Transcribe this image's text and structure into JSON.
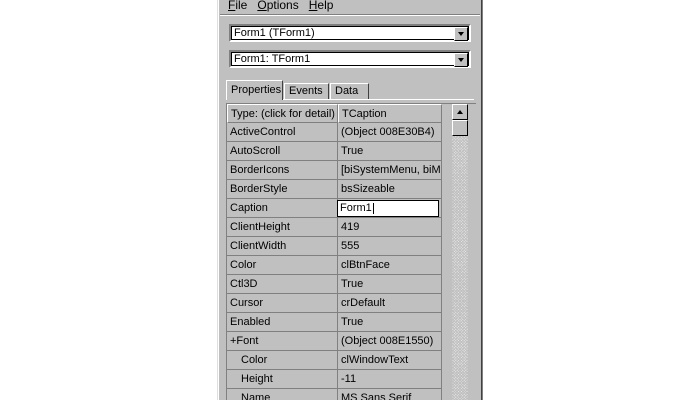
{
  "menu": {
    "items": [
      {
        "acc": "F",
        "rest": "ile"
      },
      {
        "acc": "O",
        "rest": "ptions"
      },
      {
        "acc": "H",
        "rest": "elp"
      }
    ]
  },
  "component_selector": {
    "value": "Form1 (TForm1)"
  },
  "object_selector": {
    "value": "Form1: TForm1"
  },
  "tabs": [
    {
      "label": "Properties",
      "active": true
    },
    {
      "label": "Events",
      "active": false
    },
    {
      "label": "Data",
      "active": false
    }
  ],
  "grid": {
    "header": {
      "name": "Type: (click for detail)",
      "value": "TCaption"
    },
    "rows": [
      {
        "name": "ActiveControl",
        "value": "(Object 008E30B4)"
      },
      {
        "name": "AutoScroll",
        "value": "True"
      },
      {
        "name": "BorderIcons",
        "value": "[biSystemMenu, biMin"
      },
      {
        "name": "BorderStyle",
        "value": "bsSizeable"
      },
      {
        "name": "Caption",
        "value": "Form1",
        "editing": true
      },
      {
        "name": "ClientHeight",
        "value": "419"
      },
      {
        "name": "ClientWidth",
        "value": "555"
      },
      {
        "name": "Color",
        "value": "clBtnFace"
      },
      {
        "name": "Ctl3D",
        "value": "True"
      },
      {
        "name": "Cursor",
        "value": "crDefault"
      },
      {
        "name": "Enabled",
        "value": "True"
      },
      {
        "name": "+Font",
        "value": "(Object 008E1550)"
      },
      {
        "name": "Color",
        "value": "clWindowText",
        "sub": true
      },
      {
        "name": "Height",
        "value": "-11",
        "sub": true
      },
      {
        "name": "Name",
        "value": "MS Sans Serif",
        "sub": true
      }
    ]
  }
}
